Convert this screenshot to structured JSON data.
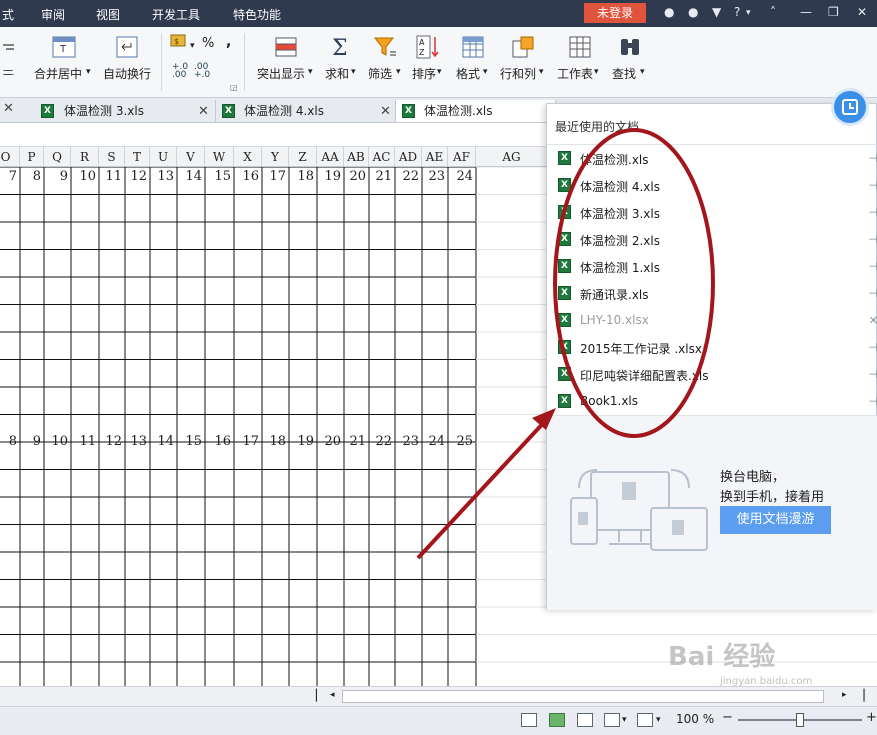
{
  "menubar": {
    "items": [
      "式",
      "审阅",
      "视图",
      "开发工具",
      "特色功能"
    ],
    "login": "未登录",
    "help": "?"
  },
  "ribbon": {
    "merge_center": "合并居中",
    "wrap_text": "自动换行",
    "percent": "%",
    "comma": ",",
    "highlight": "突出显示",
    "sum": "求和",
    "filter": "筛选",
    "sort": "排序",
    "format": "格式",
    "rowcol": "行和列",
    "worksheet": "工作表",
    "find": "查找"
  },
  "tabs": [
    {
      "label": "体温检测 3.xls"
    },
    {
      "label": "体温检测 4.xls"
    },
    {
      "label": "体温检测.xls"
    }
  ],
  "sheet": {
    "columns": [
      "O",
      "P",
      "Q",
      "R",
      "S",
      "T",
      "U",
      "V",
      "W",
      "X",
      "Y",
      "Z",
      "AA",
      "AB",
      "AC",
      "AD",
      "AE",
      "AF",
      "AG"
    ],
    "row_numbers_top": [
      "7",
      "8",
      "9",
      "10",
      "11",
      "12",
      "13",
      "14",
      "15",
      "16",
      "17",
      "18",
      "19",
      "20",
      "21",
      "22",
      "23",
      "24"
    ],
    "row_numbers_mid": [
      "8",
      "9",
      "10",
      "11",
      "12",
      "13",
      "14",
      "15",
      "16",
      "17",
      "18",
      "19",
      "20",
      "21",
      "22",
      "23",
      "24",
      "25"
    ]
  },
  "recent_panel": {
    "title": "最近使用的文档",
    "files": [
      {
        "name": "体温检测.xls",
        "dim": false
      },
      {
        "name": "体温检测 4.xls",
        "dim": false
      },
      {
        "name": "体温检测 3.xls",
        "dim": false
      },
      {
        "name": "体温检测 2.xls",
        "dim": false
      },
      {
        "name": "体温检测 1.xls",
        "dim": false
      },
      {
        "name": "新通讯录.xls",
        "dim": false
      },
      {
        "name": "LHY-10.xlsx",
        "dim": true
      },
      {
        "name": "2015年工作记录 .xlsx",
        "dim": false
      },
      {
        "name": "印尼吨袋详细配置表.xls",
        "dim": false
      },
      {
        "name": "Book1.xls",
        "dim": false
      }
    ],
    "promo_line1": "换台电脑，",
    "promo_line2": "换到手机，接着用",
    "roam_button": "使用文档漫游"
  },
  "statusbar": {
    "zoom": "100 %",
    "zoom_level": 0.5
  },
  "watermark": {
    "brand": "Bai 经验",
    "url": "jingyan.baidu.com"
  },
  "colors": {
    "menubar_bg": "#2f3a4e",
    "login_red": "#e0533d",
    "annotation_red": "#a3161c",
    "roam_blue": "#5b9ef0",
    "excel_green": "#1e7a3c"
  }
}
